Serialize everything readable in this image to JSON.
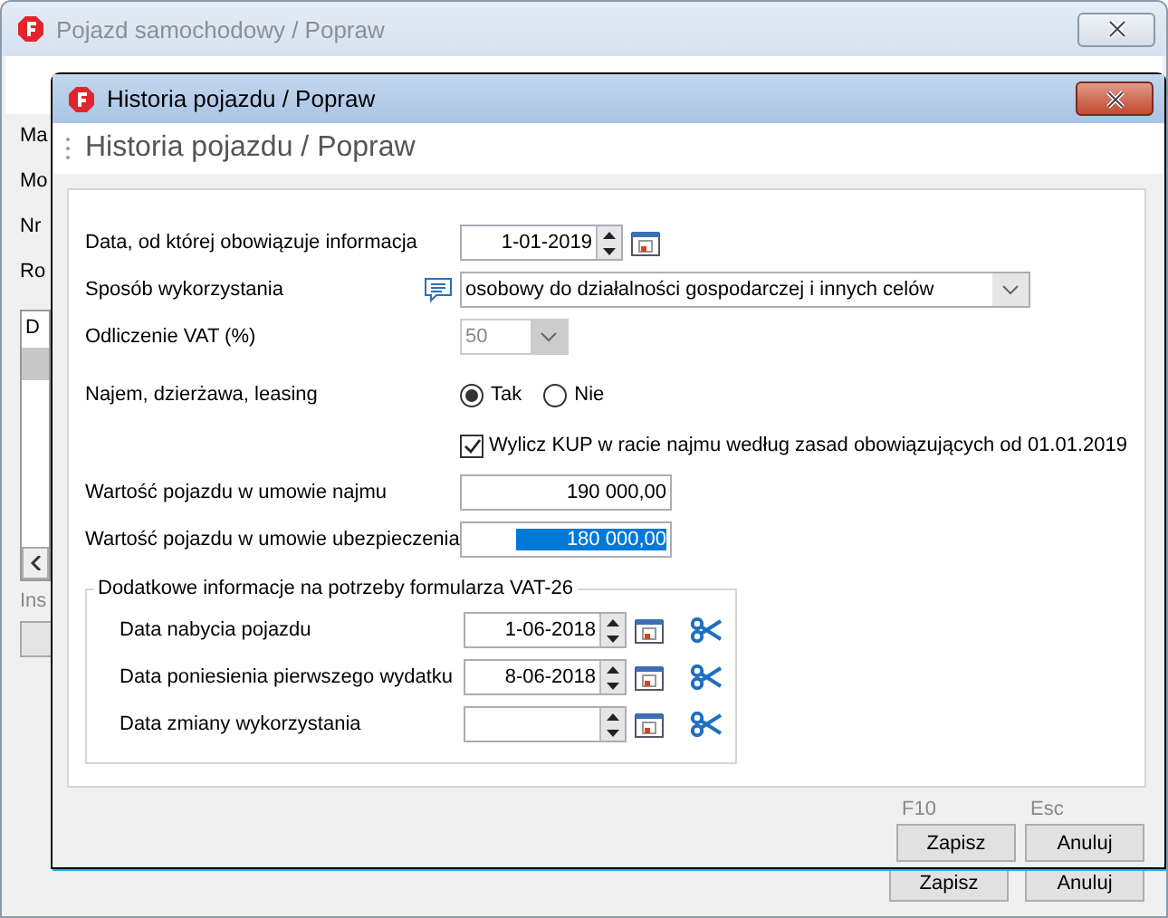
{
  "background_window": {
    "title": "Pojazd samochodowy / Popraw",
    "labels": [
      "Ma",
      "Mo",
      "Nr",
      "Ro"
    ],
    "list": {
      "column_1": "D"
    },
    "label_2": "Ins",
    "buttons": [
      "Zapisz",
      "Anuluj"
    ]
  },
  "dialog": {
    "title": "Historia pojazdu / Popraw",
    "header": "Historia pojazdu / Popraw",
    "fields": [
      {
        "kind": "date",
        "label": "Data, od której obowiązuje informacja",
        "value": "1-01-2019"
      },
      {
        "kind": "select",
        "label": "Sposób wykorzystania",
        "value": "osobowy do działalności gospodarczej i innych celów",
        "disabled": false,
        "note": true
      },
      {
        "kind": "select",
        "label": "Odliczenie VAT (%)",
        "value": "50",
        "disabled": true,
        "note": false
      },
      {
        "kind": "radio",
        "label": "Najem, dzierżawa, leasing",
        "options": [
          {
            "label": "Tak",
            "selected": true
          },
          {
            "label": "Nie",
            "selected": false
          }
        ]
      },
      {
        "kind": "checkbox",
        "label": "Wylicz KUP w racie najmu według zasad obowiązujących od 01.01.2019",
        "checked": true
      },
      {
        "kind": "amount",
        "label": "Wartość pojazdu w umowie najmu",
        "value": "190 000,00",
        "selected": false
      },
      {
        "kind": "amount",
        "label": "Wartość pojazdu w umowie ubezpieczenia",
        "value": "180 000,00",
        "selected": true
      }
    ],
    "group": {
      "title": "Dodatkowe informacje na potrzeby formularza VAT-26",
      "dates": [
        {
          "label": "Data nabycia pojazdu",
          "value": "1-06-2018"
        },
        {
          "label": "Data poniesienia pierwszego wydatku",
          "value": "8-06-2018"
        },
        {
          "label": "Data zmiany wykorzystania"
        }
      ]
    },
    "shortcuts": [
      {
        "key": "F10",
        "label": "Zapisz"
      },
      {
        "key": "Esc",
        "label": "Anuluj"
      }
    ]
  }
}
